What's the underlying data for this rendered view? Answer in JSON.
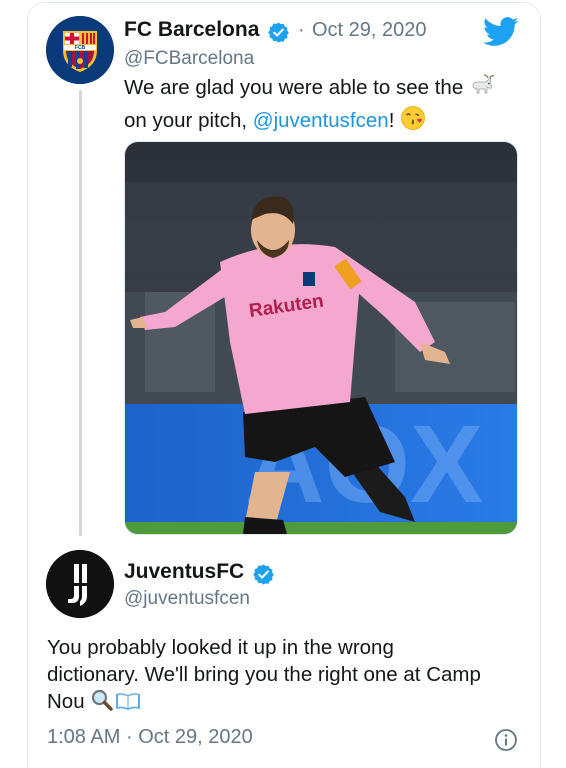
{
  "tweet": {
    "author_name": "FC Barcelona",
    "author_handle": "@FCBarcelona",
    "separator": "·",
    "date": "Oct 29, 2020",
    "text_line1": "We are glad you were able to see the",
    "text_line2_before": "on your pitch, ",
    "mention": "@juventusfcen",
    "text_line2_after": "!",
    "goat_icon": "goat-emoji",
    "kiss_icon": "kissing-face-emoji",
    "image_shirt_text": "Rakuten"
  },
  "reply": {
    "author_name": "JuventusFC",
    "author_handle": "@juventusfcen",
    "text_line1": "You probably looked it up in the wrong",
    "text_line2": "dictionary. We'll bring you the right one at Camp",
    "text_line3": "Nou",
    "icons": [
      "magnifying-glass-emoji",
      "open-book-emoji"
    ],
    "time": "1:08 AM",
    "date": "Oct 29, 2020"
  },
  "colors": {
    "link": "#1b95e0",
    "verified": "#1da1f2",
    "muted": "#657786",
    "barca_blue": "#0b3a7a",
    "shirt_pink": "#f4a8d0"
  }
}
